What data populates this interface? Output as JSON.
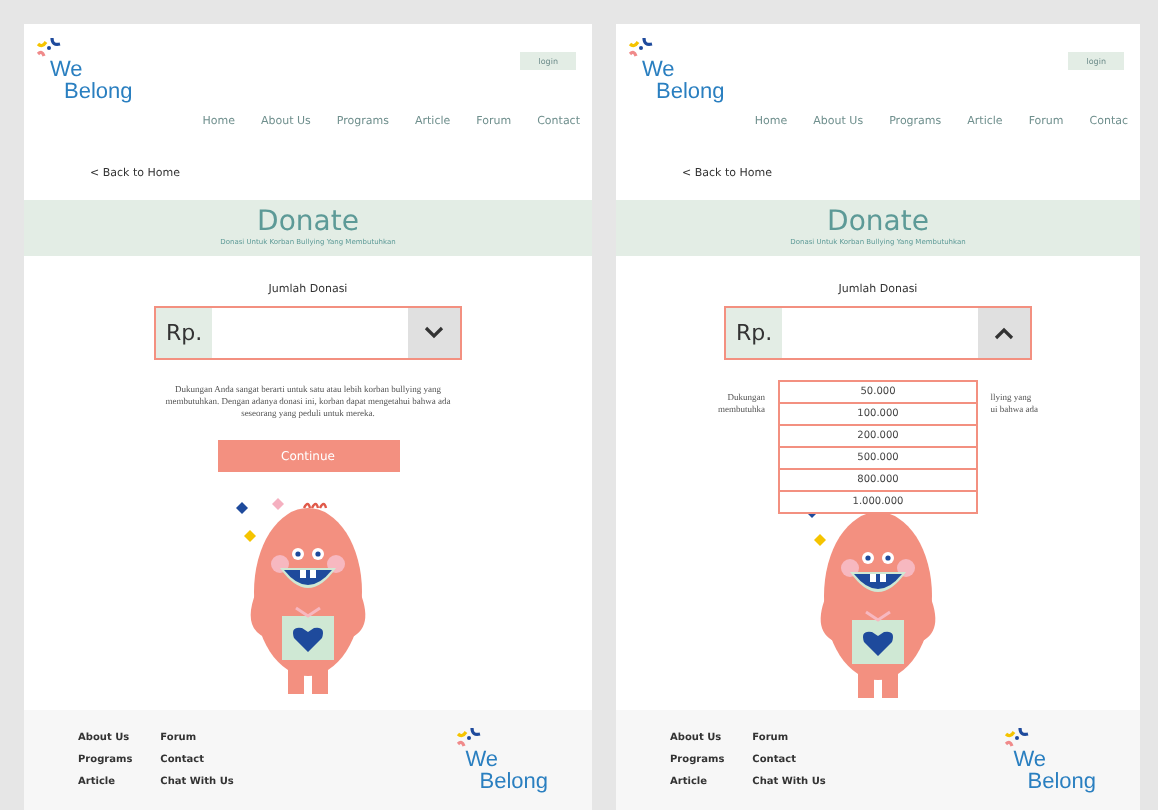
{
  "frames": [
    {
      "logo": {
        "line1": "We",
        "line2": "Belong"
      },
      "login": "login",
      "nav": [
        "Home",
        "About Us",
        "Programs",
        "Article",
        "Forum",
        "Contact"
      ],
      "back": "< Back to Home",
      "banner": {
        "title": "Donate",
        "subtitle": "Donasi Untuk Korban Bullying Yang Membutuhkan"
      },
      "amount_label": "Jumlah Donasi",
      "currency": "Rp.",
      "expanded": false,
      "paragraph": "Dukungan Anda sangat berarti untuk satu atau lebih korban bullying yang membutuhkan. Dengan adanya donasi ini, korban dapat mengetahui bahwa ada seseorang yang peduli untuk mereka.",
      "continue": "Continue",
      "footer": {
        "links": [
          [
            "About Us",
            "Programs",
            "Article"
          ],
          [
            "Forum",
            "Contact",
            "Chat With Us"
          ]
        ],
        "logo": {
          "line1": "We",
          "line2": "Belong"
        }
      }
    },
    {
      "logo": {
        "line1": "We",
        "line2": "Belong"
      },
      "login": "login",
      "nav": [
        "Home",
        "About Us",
        "Programs",
        "Article",
        "Forum",
        "Contac"
      ],
      "back": "< Back to Home",
      "banner": {
        "title": "Donate",
        "subtitle": "Donasi Untuk Korban Bullying Yang Membutuhkan"
      },
      "amount_label": "Jumlah Donasi",
      "currency": "Rp.",
      "expanded": true,
      "options": [
        "50.000",
        "100.000",
        "200.000",
        "500.000",
        "800.000",
        "1.000.000"
      ],
      "paragraph_left": [
        "Dukungan",
        "membutuhka"
      ],
      "paragraph_right": [
        "llying yang",
        "ui bahwa ada"
      ],
      "footer": {
        "links": [
          [
            "About Us",
            "Programs",
            "Article"
          ],
          [
            "Forum",
            "Contact",
            "Chat With Us"
          ]
        ],
        "logo": {
          "line1": "We",
          "line2": "Belong"
        }
      }
    }
  ]
}
